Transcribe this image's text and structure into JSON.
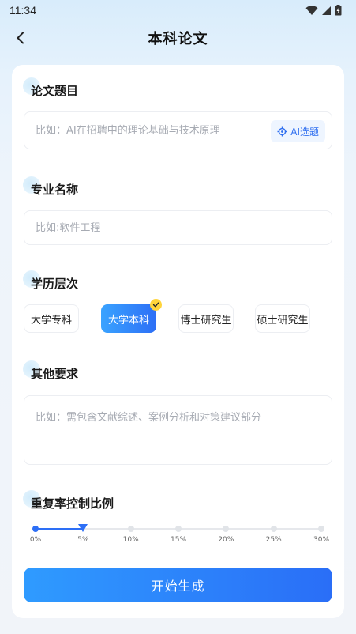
{
  "status_bar": {
    "time": "11:34"
  },
  "nav": {
    "title": "本科论文"
  },
  "sections": {
    "topic": {
      "title": "论文题目",
      "placeholder": "比如：AI在招聘中的理论基础与技术原理",
      "ai_button": "AI选题"
    },
    "major": {
      "title": "专业名称",
      "placeholder": "比如:软件工程"
    },
    "level": {
      "title": "学历层次",
      "options": [
        "大学专科",
        "大学本科",
        "博士研究生",
        "硕士研究生"
      ],
      "selected": "大学本科"
    },
    "other": {
      "title": "其他要求",
      "placeholder": "比如：需包含文献综述、案例分析和对策建议部分"
    },
    "repeat_rate": {
      "title": "重复率控制比例",
      "ticks": [
        "0%",
        "5%",
        "10%",
        "15%",
        "20%",
        "25%",
        "30%"
      ],
      "selected": "5%"
    }
  },
  "submit": {
    "label": "开始生成"
  }
}
